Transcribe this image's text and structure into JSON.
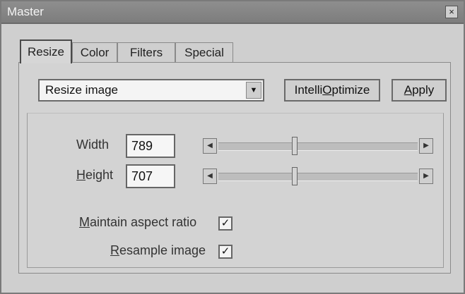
{
  "window": {
    "title": "Master",
    "close_glyph": "×"
  },
  "tabs": [
    {
      "label": "Resize",
      "active": true
    },
    {
      "label": "Color",
      "active": false
    },
    {
      "label": "Filters",
      "active": false
    },
    {
      "label": "Special",
      "active": false
    }
  ],
  "mode_select": {
    "value": "Resize image"
  },
  "buttons": {
    "intellioptimize_pre": "Intelli",
    "intellioptimize_ul": "O",
    "intellioptimize_post": "ptimize",
    "apply_ul": "A",
    "apply_post": "pply"
  },
  "size": {
    "width_label": "Width",
    "width_value": "789",
    "height_label_ul": "H",
    "height_label_post": "eight",
    "height_value": "707",
    "width_slider_fraction": 0.38,
    "height_slider_fraction": 0.38
  },
  "options": {
    "aspect_ul": "M",
    "aspect_post": "aintain aspect ratio",
    "aspect_checked": true,
    "resample_ul": "R",
    "resample_post": "esample image",
    "resample_checked": true,
    "check_glyph": "✓"
  },
  "icons": {
    "dropdown": "dropdown-arrow-icon",
    "left": "scroll-left-icon",
    "right": "scroll-right-icon"
  }
}
